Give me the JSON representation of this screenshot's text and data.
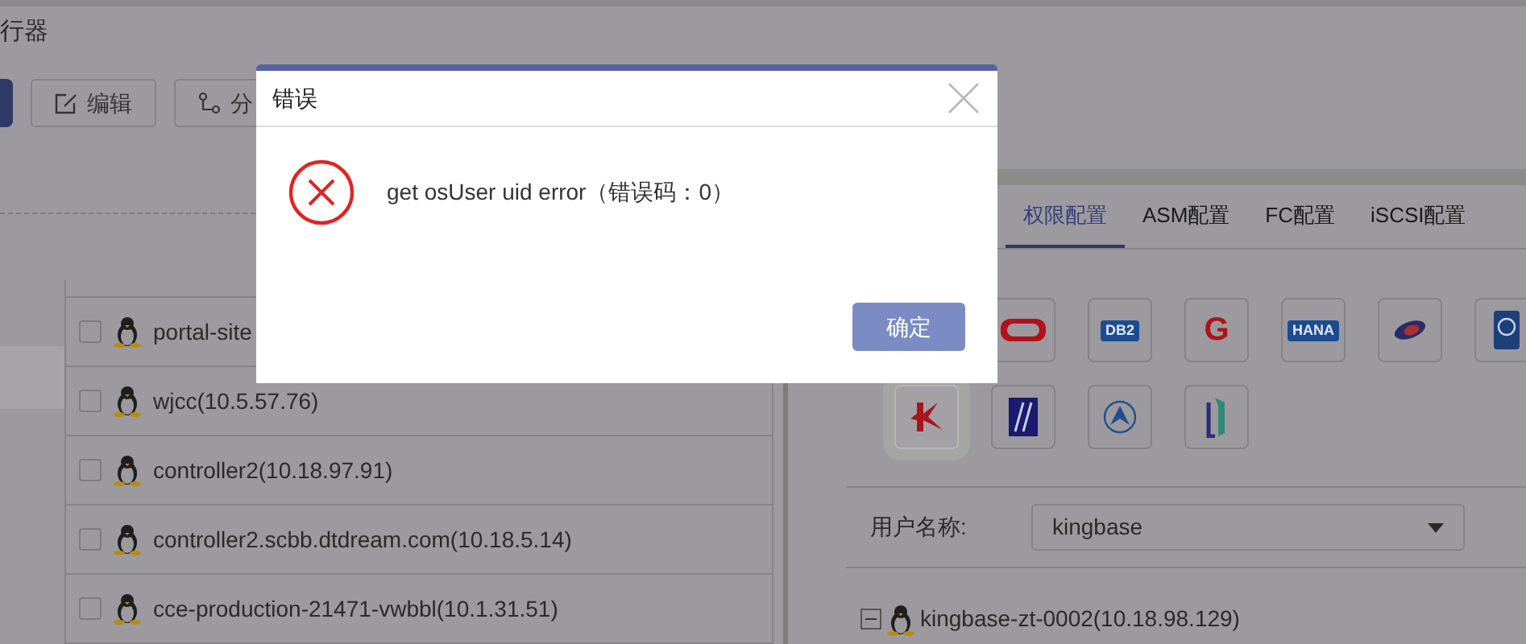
{
  "page": {
    "title": "行器"
  },
  "toolbar": [
    {
      "kind": "edit",
      "label": "编辑"
    },
    {
      "kind": "branch",
      "label": "分"
    }
  ],
  "hosts": [
    {
      "name": "portal-site",
      "checked": false
    },
    {
      "name": "wjcc(10.5.57.76)",
      "checked": false
    },
    {
      "name": "controller2(10.18.97.91)",
      "checked": false
    },
    {
      "name": "controller2.scbb.dtdream.com(10.18.5.14)",
      "checked": false
    },
    {
      "name": "cce-production-21471-vwbbl(10.1.31.51)",
      "checked": false
    }
  ],
  "tabs": [
    {
      "label": "权限配置",
      "selected": true
    },
    {
      "label": "ASM配置",
      "selected": false
    },
    {
      "label": "FC配置",
      "selected": false
    },
    {
      "label": "iSCSI配置",
      "selected": false
    }
  ],
  "db_icons": [
    [
      {
        "kind": "ring",
        "selected": false
      },
      {
        "kind": "badge",
        "label": "DB2",
        "selected": false
      },
      {
        "kind": "letter",
        "label": "G",
        "selected": false
      },
      {
        "kind": "badge",
        "label": "HANA",
        "selected": false
      },
      {
        "kind": "swirl",
        "selected": false
      },
      {
        "kind": "moon",
        "selected": false
      }
    ],
    [
      {
        "kind": "k",
        "selected": true
      },
      {
        "kind": "slash",
        "selected": false
      },
      {
        "kind": "peak",
        "selected": false
      },
      {
        "kind": "bracket",
        "selected": false
      }
    ]
  ],
  "user_field": {
    "label": "用户名称:",
    "value": "kingbase"
  },
  "tree": [
    {
      "label": "kingbase-zt-0002(10.18.98.129)",
      "expanded": true
    }
  ],
  "dialog": {
    "title": "错误",
    "message": "get osUser uid error（错误码：0）",
    "button": "确定"
  }
}
